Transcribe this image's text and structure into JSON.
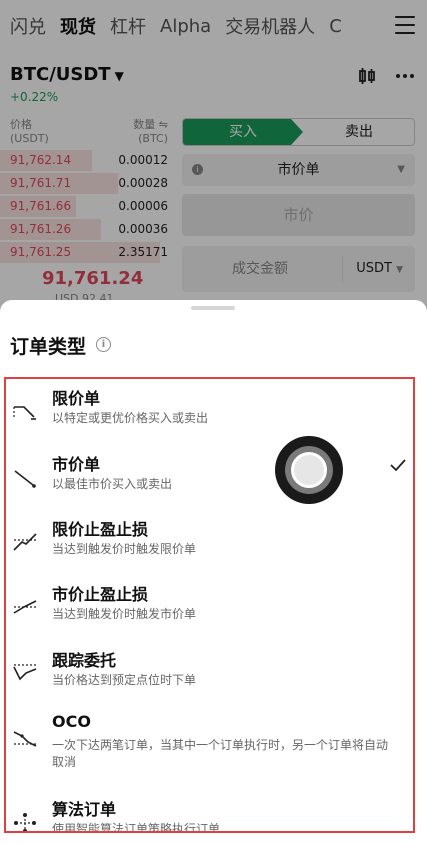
{
  "top_tabs": [
    "闪兑",
    "现货",
    "杠杆",
    "Alpha",
    "交易机器人",
    "C"
  ],
  "active_tab_index": 1,
  "pair": {
    "symbol": "BTC/USDT",
    "change": "+0.22%"
  },
  "orderbook": {
    "price_header": "价格",
    "price_unit": "(USDT)",
    "qty_header": "数量 ⇋",
    "qty_unit": "(BTC)",
    "rows": [
      {
        "price": "91,762.14",
        "qty": "0.00012",
        "depth": 0.55
      },
      {
        "price": "91,761.71",
        "qty": "0.00028",
        "depth": 0.7
      },
      {
        "price": "91,761.66",
        "qty": "0.00006",
        "depth": 0.45
      },
      {
        "price": "91,761.26",
        "qty": "0.00036",
        "depth": 0.6
      },
      {
        "price": "91,761.25",
        "qty": "2.35171",
        "depth": 0.95
      }
    ],
    "last_price": "91,761.24",
    "last_price_sub": "USD 92.41"
  },
  "trade_form": {
    "buy_label": "买入",
    "sell_label": "卖出",
    "order_type": "市价单",
    "price_placeholder": "市价",
    "amount_label": "成交金额",
    "amount_currency": "USDT"
  },
  "sheet": {
    "title": "订单类型",
    "options": [
      {
        "name": "限价单",
        "desc": "以特定或更优价格买入或卖出",
        "icon": "limit-order-icon",
        "selected": false
      },
      {
        "name": "市价单",
        "desc": "以最佳市价买入或卖出",
        "icon": "market-order-icon",
        "selected": true
      },
      {
        "name": "限价止盈止损",
        "desc": "当达到触发价时触发限价单",
        "icon": "limit-tp-sl-icon",
        "selected": false
      },
      {
        "name": "市价止盈止损",
        "desc": "当达到触发价时触发市价单",
        "icon": "market-tp-sl-icon",
        "selected": false
      },
      {
        "name": "跟踪委托",
        "desc": "当价格达到预定点位时下单",
        "icon": "trailing-order-icon",
        "selected": false
      },
      {
        "name": "OCO",
        "desc": "一次下达两笔订单，当其中一个订单执行时，另一个订单将自动取消",
        "icon": "oco-icon",
        "selected": false
      },
      {
        "name": "算法订单",
        "desc": "使用智能算法订单策略执行订单",
        "icon": "algo-order-icon",
        "selected": false
      }
    ]
  },
  "colors": {
    "buy": "#1a9c5a",
    "sell": "#e0475f",
    "highlight_border": "#e04040"
  }
}
